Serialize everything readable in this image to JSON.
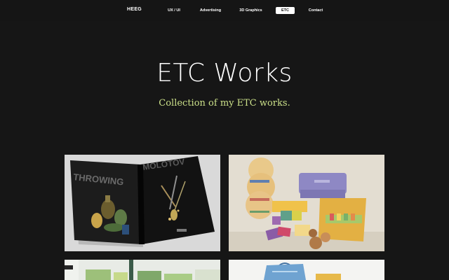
{
  "header": {
    "brand": "HEEG",
    "nav": [
      {
        "label": "UX / UI"
      },
      {
        "label": "Advertising"
      },
      {
        "label": "3D Graphics"
      },
      {
        "label": "ETC",
        "active": true
      },
      {
        "label": "Contact"
      }
    ]
  },
  "hero": {
    "title": "ETC Works",
    "subtitle": "Collection of my ETC works."
  },
  "colors": {
    "background": "#161616",
    "subtitle": "#cbe089",
    "active_nav_bg": "#ffffff"
  },
  "projects": [
    {
      "thumbnail": "magazine-spread-throwing-image",
      "magazine_text_left": "THROWING",
      "magazine_text_right": "MOLOTOV"
    },
    {
      "thumbnail": "packaging-boxes-image"
    },
    {
      "thumbnail": "green-posters-image"
    },
    {
      "thumbnail": "shopping-bag-image"
    }
  ]
}
